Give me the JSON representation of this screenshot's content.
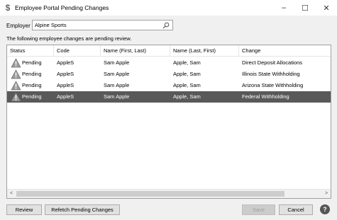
{
  "window": {
    "title": "Employee Portal Pending Changes",
    "app_icon": "dollar-icon",
    "controls": {
      "minimize": "–",
      "maximize": "☐",
      "close": "✕"
    }
  },
  "employer": {
    "label": "Employer",
    "value": "Alpine Sports"
  },
  "info_text": "The following employee changes are pending review.",
  "grid": {
    "columns": [
      "Status",
      "Code",
      "Name (First, Last)",
      "Name (Last, First)",
      "Change"
    ],
    "rows": [
      {
        "status": "Pending",
        "code": "AppleS",
        "name_first_last": "Sam Apple",
        "name_last_first": "Apple, Sam",
        "change": "Direct Deposit Allocations",
        "selected": false
      },
      {
        "status": "Pending",
        "code": "AppleS",
        "name_first_last": "Sam Apple",
        "name_last_first": "Apple, Sam",
        "change": "Illinois State Withholding",
        "selected": false
      },
      {
        "status": "Pending",
        "code": "AppleS",
        "name_first_last": "Sam Apple",
        "name_last_first": "Apple, Sam",
        "change": "Arizona State Withholding",
        "selected": false
      },
      {
        "status": "Pending",
        "code": "AppleS",
        "name_first_last": "Sam Apple",
        "name_last_first": "Apple, Sam",
        "change": "Federal Withholding",
        "selected": true
      }
    ],
    "scroll_left": "<",
    "scroll_right": ">"
  },
  "buttons": {
    "review": "Review",
    "refetch": "Refetch Pending Changes",
    "save": "Save",
    "cancel": "Cancel",
    "help": "?"
  },
  "colors": {
    "selected_row": "#595959",
    "warning_fill": "#9a9a9a"
  }
}
